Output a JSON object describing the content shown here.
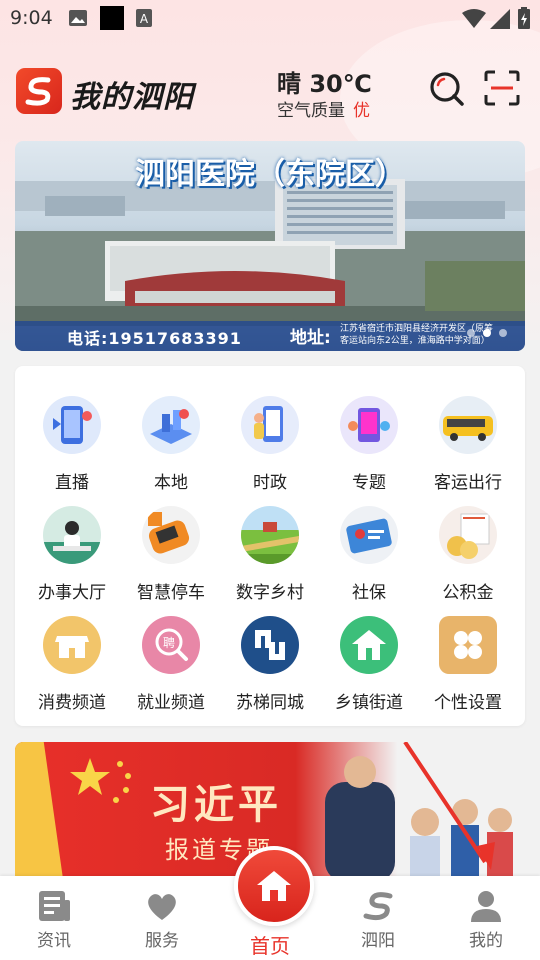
{
  "status_bar": {
    "time": "9:04"
  },
  "header": {
    "app_name": "我的泗阳",
    "weather": "晴 30℃",
    "air_quality_label": "空气质量",
    "air_quality_value": "优"
  },
  "banner": {
    "title": "泗阳医院（东院区）",
    "phone": "电话:19517683391",
    "address_label": "地址:",
    "address": "江苏省宿迁市泗阳县经济开发区（原筹客运站向东2公里，淮海路中学对面）",
    "slide_count": 3,
    "active_slide": 2
  },
  "grid": {
    "items": [
      {
        "label": "直播",
        "icon": "live-icon"
      },
      {
        "label": "本地",
        "icon": "local-icon"
      },
      {
        "label": "时政",
        "icon": "politics-icon"
      },
      {
        "label": "专题",
        "icon": "topic-icon"
      },
      {
        "label": "客运出行",
        "icon": "bus-icon"
      },
      {
        "label": "办事大厅",
        "icon": "service-hall-icon"
      },
      {
        "label": "智慧停车",
        "icon": "parking-icon"
      },
      {
        "label": "数字乡村",
        "icon": "village-icon"
      },
      {
        "label": "社保",
        "icon": "social-security-icon"
      },
      {
        "label": "公积金",
        "icon": "housing-fund-icon"
      },
      {
        "label": "消费频道",
        "icon": "shop-icon"
      },
      {
        "label": "就业频道",
        "icon": "job-icon"
      },
      {
        "label": "苏梯同城",
        "icon": "sutong-icon"
      },
      {
        "label": "乡镇街道",
        "icon": "town-icon"
      },
      {
        "label": "个性设置",
        "icon": "settings-icon"
      }
    ]
  },
  "promo": {
    "title": "习近平",
    "subtitle": "报道专题"
  },
  "tabbar": {
    "tabs": [
      {
        "label": "资讯",
        "icon": "news-icon"
      },
      {
        "label": "服务",
        "icon": "heart-icon"
      },
      {
        "label": "首页",
        "icon": "home-icon"
      },
      {
        "label": "泗阳",
        "icon": "siyang-icon"
      },
      {
        "label": "我的",
        "icon": "profile-icon"
      }
    ],
    "active": "首页"
  },
  "colors": {
    "accent": "#e8332a",
    "banner_blue": "#1a5ea8"
  }
}
